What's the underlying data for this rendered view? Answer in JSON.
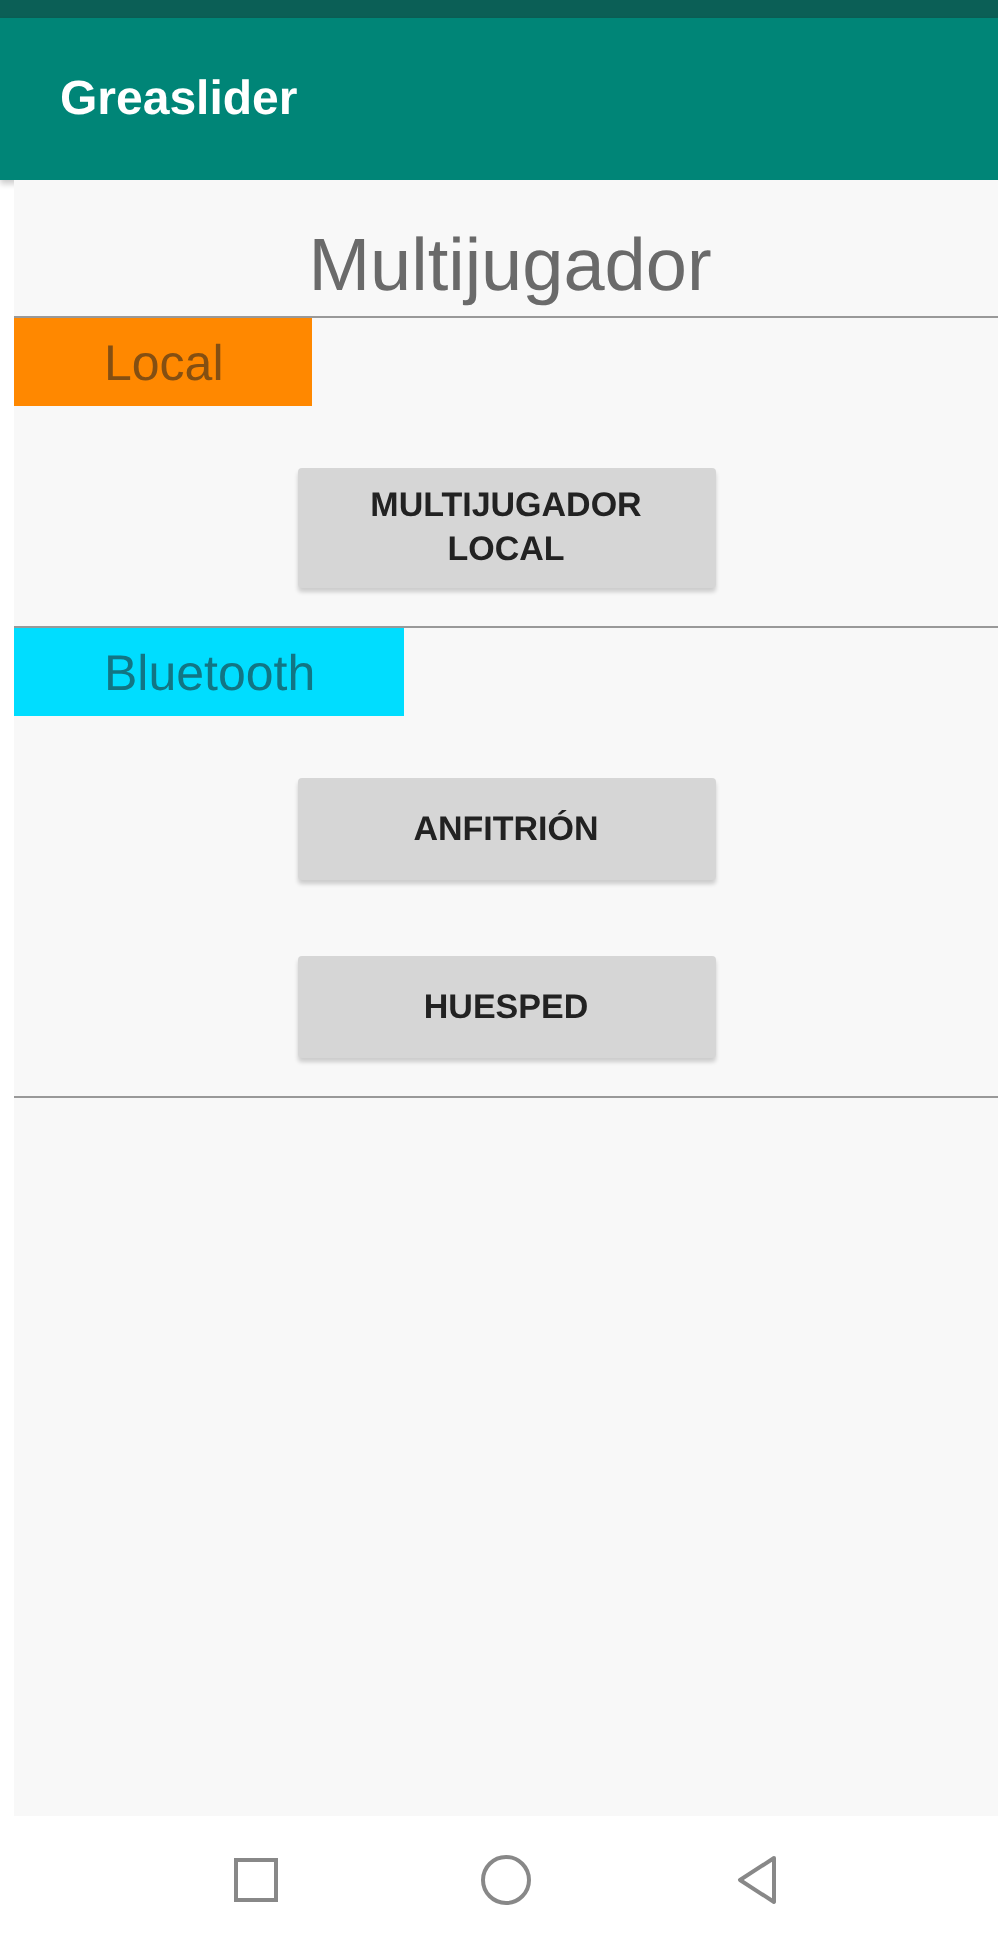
{
  "app_bar": {
    "title": "Greaslider"
  },
  "screen": {
    "title": "Multijugador"
  },
  "sections": [
    {
      "label": "Local",
      "color": "#ff8800",
      "buttons": [
        "MULTIJUGADOR\nLOCAL"
      ]
    },
    {
      "label": "Bluetooth",
      "color": "#00ddff",
      "buttons": [
        "ANFITRIÓN",
        "HUESPED"
      ]
    }
  ]
}
